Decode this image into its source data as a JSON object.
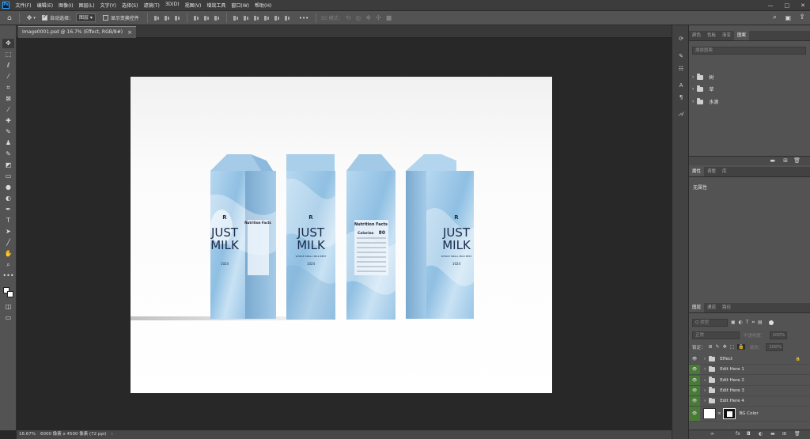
{
  "app": {
    "logo": "Ps",
    "window_controls": [
      "—",
      "□",
      "✕"
    ]
  },
  "menu": [
    "文件(F)",
    "编辑(E)",
    "图像(I)",
    "图层(L)",
    "文字(Y)",
    "选择(S)",
    "滤镜(T)",
    "3D(D)",
    "视图(V)",
    "增效工具",
    "窗口(W)",
    "帮助(H)"
  ],
  "options": {
    "auto_select_label": "自动选择：",
    "auto_select_value": "图层",
    "transform_label": "显示变换控件",
    "more": "•••",
    "mode_3d": "3D 模式："
  },
  "document": {
    "tab_title": "Image0001.psd @ 16.7% (Effect, RGB/8#)",
    "close": "×"
  },
  "status": {
    "zoom": "16.67%",
    "info": "6000 像素 x 4500 像素 (72 ppi)",
    "arrow": "›"
  },
  "panels": {
    "top_tabs": [
      "颜色",
      "色板",
      "渐变",
      "图案"
    ],
    "search_placeholder": "搜索图案",
    "pattern_groups": [
      "树",
      "草",
      "水滴"
    ],
    "props_tabs": [
      "属性",
      "调整",
      "库"
    ],
    "props_empty": "无属性",
    "layers_tabs": [
      "图层",
      "通道",
      "路径"
    ],
    "kind_label": "Q 类型",
    "blend_mode": "正常",
    "opacity_label": "不透明度：",
    "opacity_value": "100%",
    "lock_label": "锁定：",
    "fill_label": "填充：",
    "fill_value": "100%"
  },
  "layers": [
    {
      "name": "Effect",
      "type": "group",
      "visible_green": false,
      "locked": true
    },
    {
      "name": "Edit Here 1",
      "type": "group",
      "visible_green": true,
      "locked": false
    },
    {
      "name": "Edit Here 2",
      "type": "group",
      "visible_green": true,
      "locked": false
    },
    {
      "name": "Edit Here 3",
      "type": "group",
      "visible_green": true,
      "locked": false
    },
    {
      "name": "Edit Here 4",
      "type": "group",
      "visible_green": true,
      "locked": false
    },
    {
      "name": "BG Color",
      "type": "fill",
      "visible_green": true,
      "locked": false
    }
  ],
  "cartons": {
    "brand_mark": "R",
    "brand_line1": "JUST",
    "brand_line2": "MILK",
    "subtitle": "WHOLE SMALL MILK BEST",
    "volume": "1024",
    "nutrition_title": "Nutrition Facts",
    "calories_label": "Calories",
    "calories_value": "80"
  },
  "colors": {
    "accent_green": "#4a7a37",
    "carton_blue": "#a9d0ec",
    "photoshop_blue": "#31a8ff"
  }
}
